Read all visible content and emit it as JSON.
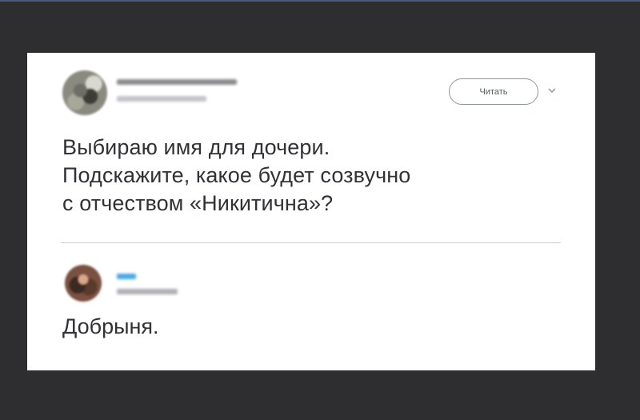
{
  "tweet": {
    "follow_label": "Читать",
    "icons": {
      "avatar": "user-avatar-icon",
      "menu": "chevron-down-icon"
    },
    "lines": [
      "Выбираю имя для дочери.",
      "Подскажите, какое будет созвучно",
      "с отчеством «Никитична»?"
    ]
  },
  "reply": {
    "text": "Добрыня."
  },
  "colors": {
    "background": "#2e2e30",
    "card": "#ffffff",
    "text": "#303236",
    "reply_name_accent": "#4aa8e8"
  }
}
